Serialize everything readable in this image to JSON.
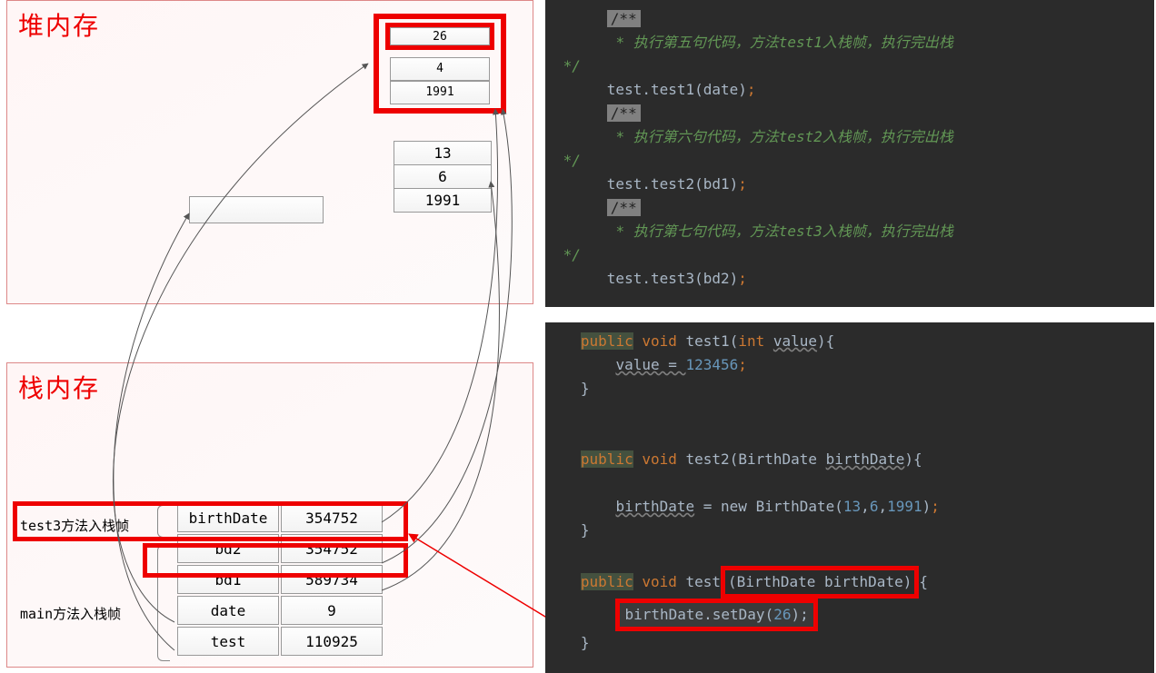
{
  "heap": {
    "title": "堆内存",
    "object1": {
      "day": "26",
      "month": "4",
      "year": "1991"
    },
    "object2": {
      "day": "13",
      "month": "6",
      "year": "1991"
    }
  },
  "stack": {
    "title": "栈内存",
    "frame_test3_label": "test3方法入栈帧",
    "frame_main_label": "main方法入栈帧",
    "rows": [
      {
        "name": "birthDate",
        "value": "354752"
      },
      {
        "name": "bd2",
        "value": "354752"
      },
      {
        "name": "bd1",
        "value": "589734"
      },
      {
        "name": "date",
        "value": "9"
      },
      {
        "name": "test",
        "value": "110925"
      }
    ]
  },
  "code1": {
    "c1": "* 执行第五句代码，方法",
    "c1b": "入栈帧，执行完出栈",
    "m1": "test1",
    "l1": "test.test1(date)",
    "c2": "* 执行第六句代码，方法",
    "m2": "test2",
    "l2": "test.test2(bd1)",
    "c3": "* 执行第七句代码，方法",
    "m3": "test3",
    "l3": "test.test3(bd2)",
    "tag": "/**",
    "end": " */"
  },
  "code2": {
    "pub": "public",
    "vd": "void",
    "t1": "test1",
    "t1p": "int",
    "t1a": "value",
    "t1b": "value = ",
    "t1n": "123456",
    "t2": "test2",
    "bdType": "BirthDate",
    "bdArg": "birthDate",
    "t2b": "birthDate",
    "t2c": " = new BirthDate(",
    "t2n1": "13",
    "t2n2": "6",
    "t2n3": "1991",
    "t3sig1": "(BirthDate birthDate)",
    "t3body": "birthDate.setDay(",
    "t3n": "26",
    "t3t": "test"
  }
}
